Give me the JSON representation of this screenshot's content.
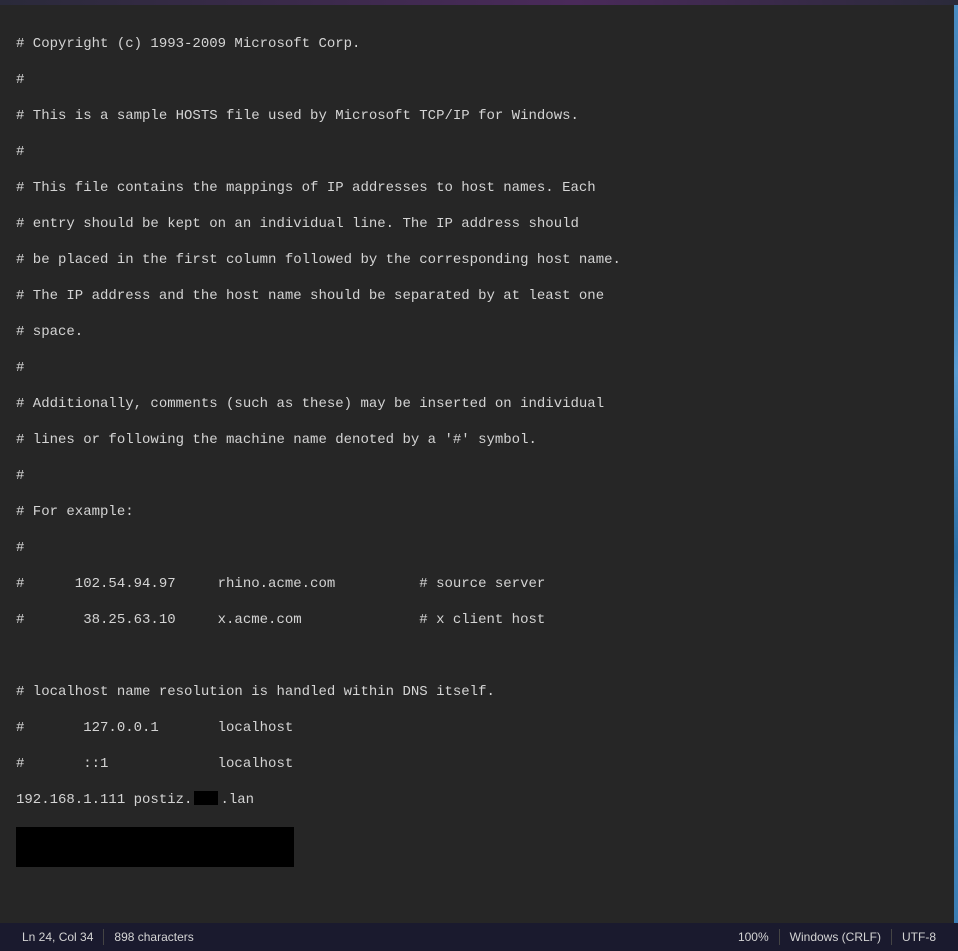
{
  "editor": {
    "lines": [
      "# Copyright (c) 1993-2009 Microsoft Corp.",
      "#",
      "# This is a sample HOSTS file used by Microsoft TCP/IP for Windows.",
      "#",
      "# This file contains the mappings of IP addresses to host names. Each",
      "# entry should be kept on an individual line. The IP address should",
      "# be placed in the first column followed by the corresponding host name.",
      "# The IP address and the host name should be separated by at least one",
      "# space.",
      "#",
      "# Additionally, comments (such as these) may be inserted on individual",
      "# lines or following the machine name denoted by a '#' symbol.",
      "#",
      "# For example:",
      "#",
      "#      102.54.94.97     rhino.acme.com          # source server",
      "#       38.25.63.10     x.acme.com              # x client host",
      "",
      "# localhost name resolution is handled within DNS itself.",
      "#       127.0.0.1       localhost",
      "#       ::1             localhost"
    ],
    "entry_prefix": "192.168.1.111 postiz.",
    "entry_suffix": ".lan"
  },
  "statusbar": {
    "cursor": "Ln 24, Col 34",
    "chars": "898 characters",
    "zoom": "100%",
    "line_ending": "Windows (CRLF)",
    "encoding": "UTF-8"
  }
}
